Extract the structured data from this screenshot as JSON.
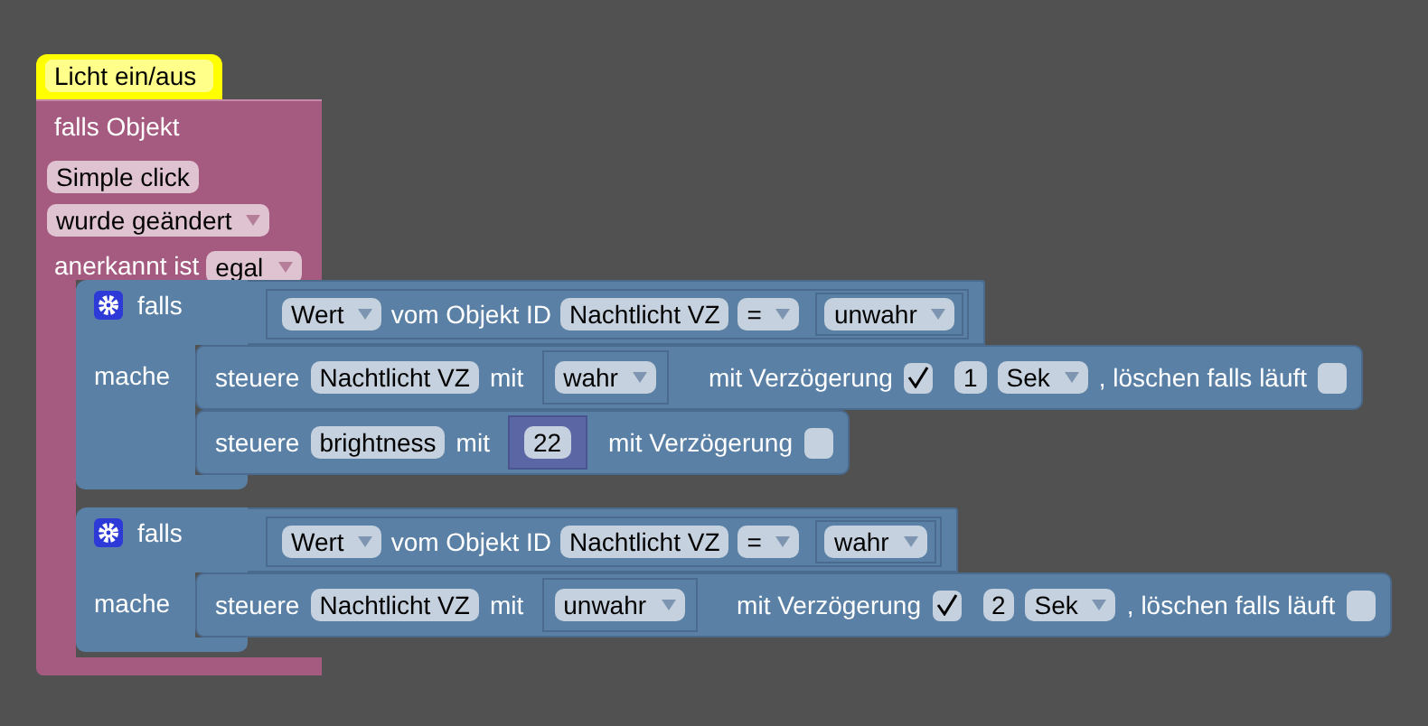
{
  "comment": "Licht ein/aus",
  "trigger": {
    "title": "falls Objekt",
    "object": "Simple click",
    "event": "wurde geändert",
    "ack_label": "anerkannt ist",
    "ack": "egal"
  },
  "if_blocks": [
    {
      "if_label": "falls",
      "do_label": "mache",
      "condition": {
        "value": "Wert",
        "of_label": "vom Objekt ID",
        "object": "Nachtlicht VZ",
        "operator": "=",
        "compare": "unwahr"
      },
      "statements": [
        {
          "label": "steuere",
          "object": "Nachtlicht VZ",
          "with_label": "mit",
          "value": {
            "kind": "dropdown",
            "text": "wahr"
          },
          "delay_label": "mit Verzögerung",
          "delay": true,
          "delay_value": "1",
          "unit": "Sek",
          "clear_label": ", löschen falls läuft",
          "clear": false
        },
        {
          "label": "steuere",
          "object": "brightness",
          "with_label": "mit",
          "value": {
            "kind": "number",
            "text": "22"
          },
          "delay_label": "mit Verzögerung",
          "delay": false
        }
      ]
    },
    {
      "if_label": "falls",
      "do_label": "mache",
      "condition": {
        "value": "Wert",
        "of_label": "vom Objekt ID",
        "object": "Nachtlicht VZ",
        "operator": "=",
        "compare": "wahr"
      },
      "statements": [
        {
          "label": "steuere",
          "object": "Nachtlicht VZ",
          "with_label": "mit",
          "value": {
            "kind": "dropdown",
            "text": "unwahr"
          },
          "delay_label": "mit Verzögerung",
          "delay": true,
          "delay_value": "2",
          "unit": "Sek",
          "clear_label": ", löschen falls läuft",
          "clear": false
        }
      ]
    }
  ]
}
